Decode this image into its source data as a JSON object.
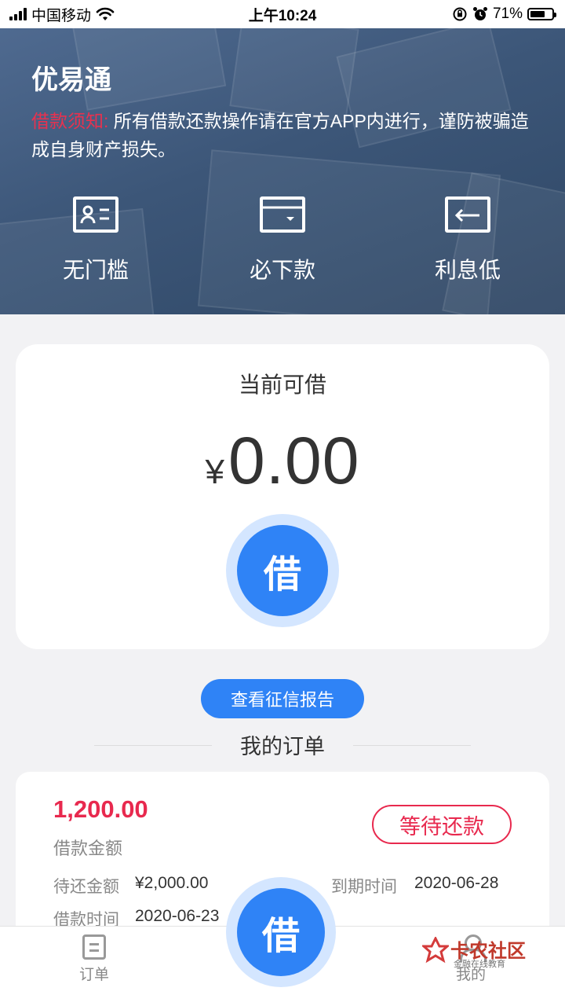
{
  "status_bar": {
    "carrier": "中国移动",
    "time": "上午10:24",
    "battery_text": "71%",
    "battery_level": 0.71
  },
  "hero": {
    "title": "优易通",
    "notice_tag": "借款须知:",
    "notice_text": "所有借款还款操作请在官方APP内进行，谨防被骗造成自身财产损失。",
    "features": [
      {
        "label": "无门槛",
        "icon": "id-card-icon"
      },
      {
        "label": "必下款",
        "icon": "bank-card-icon"
      },
      {
        "label": "利息低",
        "icon": "return-arrow-icon"
      }
    ]
  },
  "loan_card": {
    "caption": "当前可借",
    "currency": "¥",
    "amount": "0.00",
    "borrow_label": "借"
  },
  "credit_report_button": "查看征信报告",
  "orders_title": "我的订单",
  "order": {
    "amount": "1,200.00",
    "amount_label": "借款金额",
    "status": "等待还款",
    "pending_label": "待还金额",
    "pending_value": "¥2,000.00",
    "due_label": "到期时间",
    "due_value": "2020-06-28",
    "borrow_time_label": "借款时间",
    "borrow_time_value": "2020-06-23"
  },
  "tab_bar": {
    "orders_label": "订单",
    "borrow_label": "借",
    "mine_label": "我的"
  },
  "watermark": {
    "main": "卡农社区",
    "sub": "金融在线教育"
  },
  "colors": {
    "accent_blue": "#2f83f6",
    "alert_red": "#e8294e"
  }
}
